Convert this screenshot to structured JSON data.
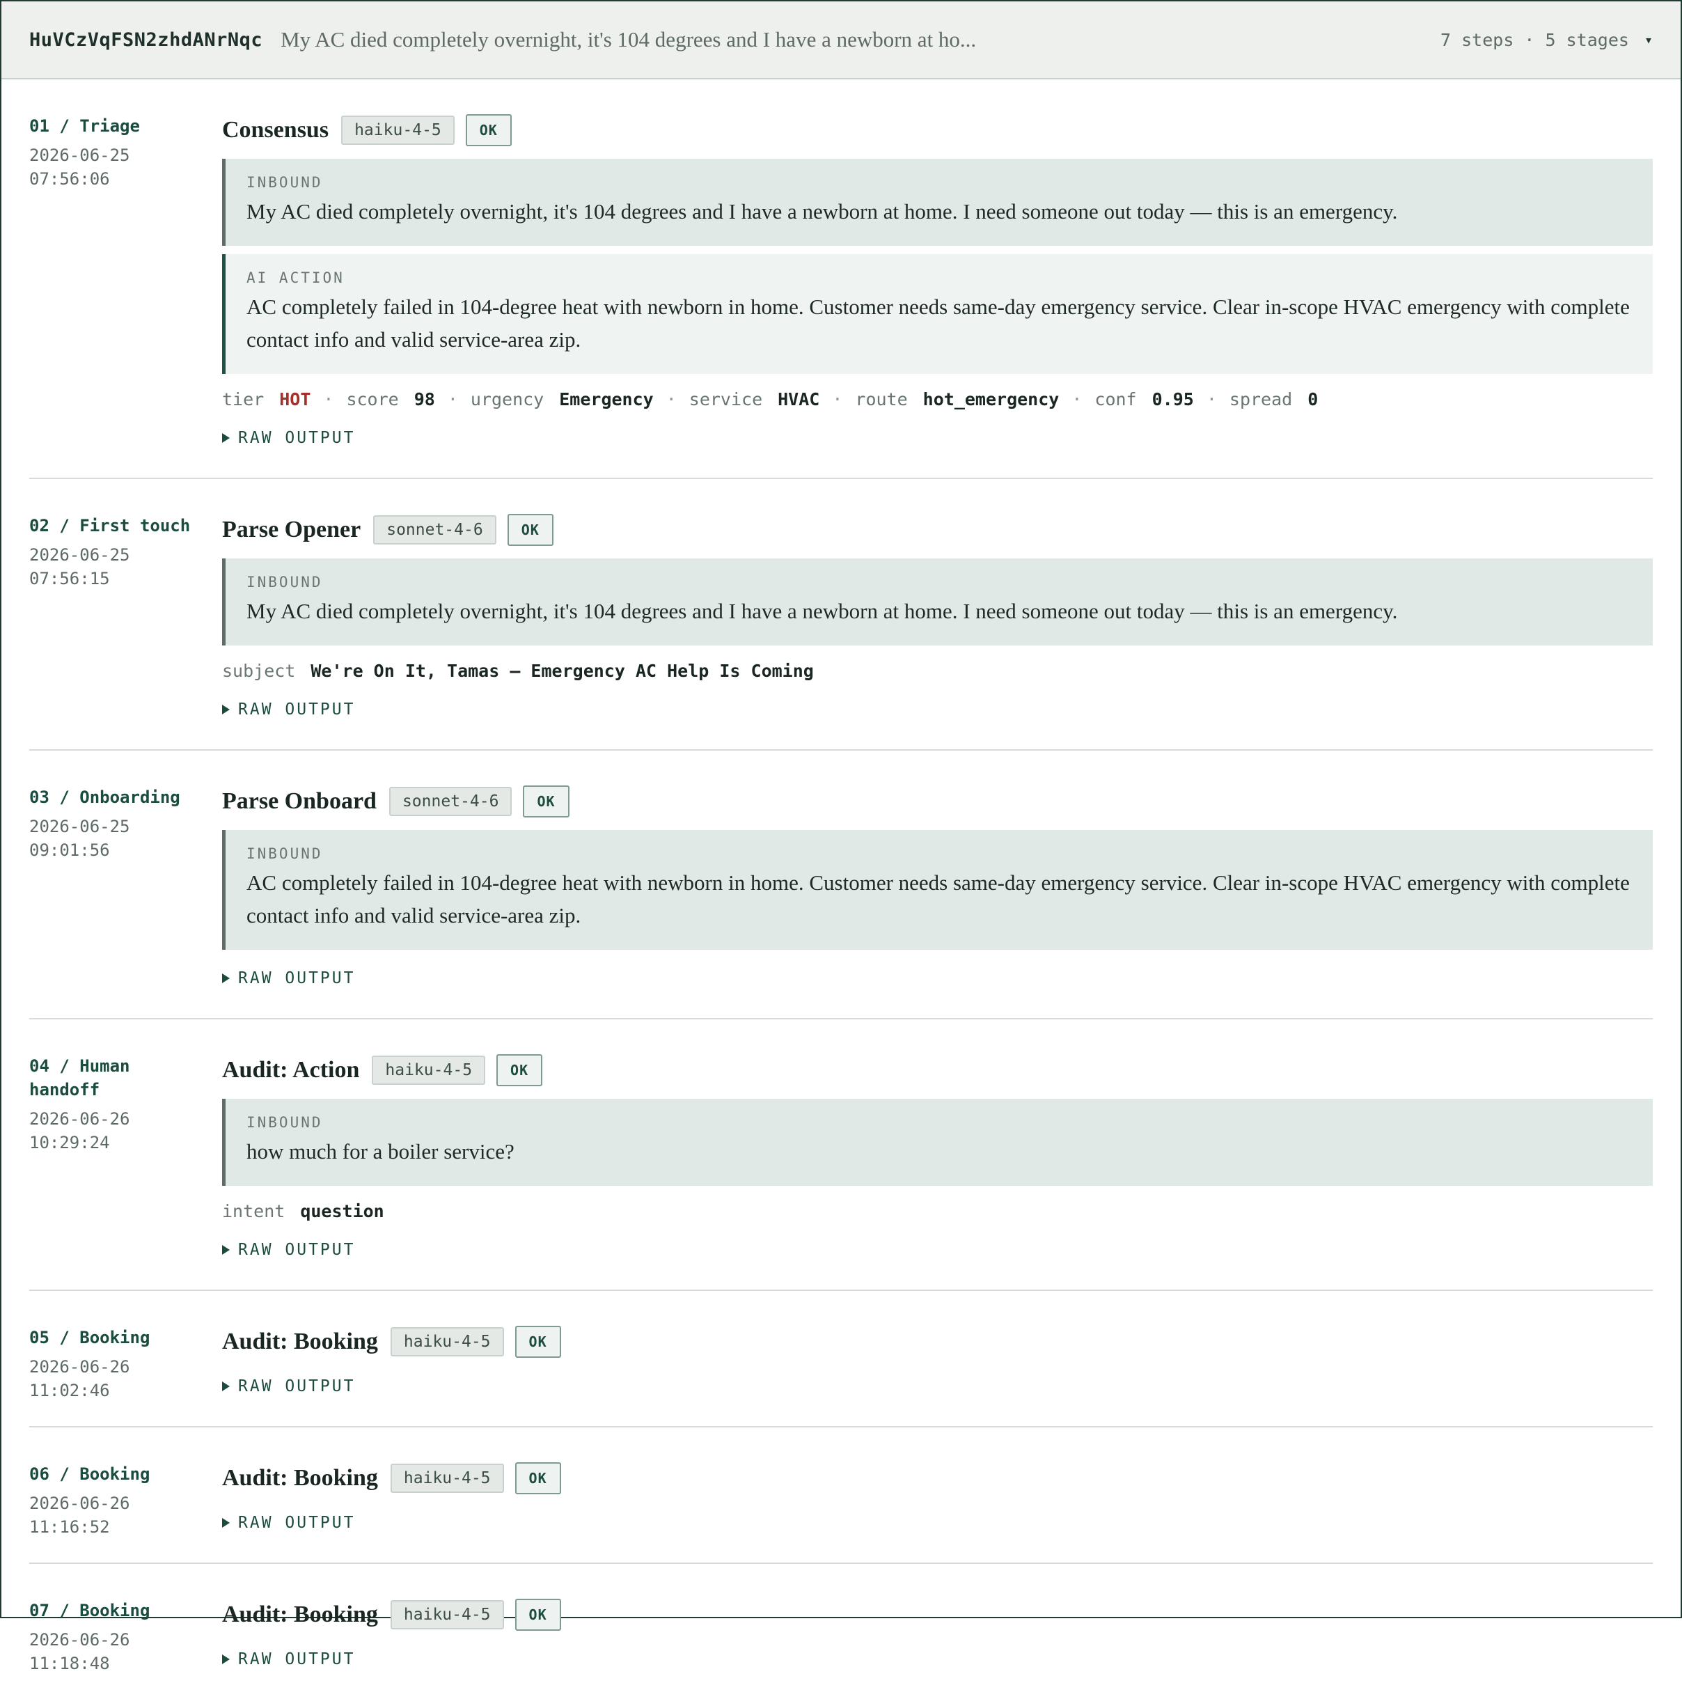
{
  "run": {
    "id": "HuVCzVqFSN2zhdANrNqc",
    "summary": "My AC died completely overnight, it's 104 degrees and I have a newborn at ho...",
    "meta": "7 steps · 5 stages",
    "chevron": "▾"
  },
  "labels": {
    "inbound": "INBOUND",
    "ai_action": "AI ACTION",
    "raw_output": "RAW OUTPUT",
    "ok": "OK"
  },
  "steps": [
    {
      "label": "01 / Triage",
      "date": "2026-06-25",
      "time": "07:56:06",
      "title": "Consensus",
      "model": "haiku-4-5",
      "status": "OK",
      "inbound": "My AC died completely overnight, it's 104 degrees and I have a newborn at home. I need someone out today — this is an emergency.",
      "ai_action": "AC completely failed in 104-degree heat with newborn in home. Customer needs same-day emergency service. Clear in-scope HVAC emergency with complete contact info and valid service-area zip.",
      "meta": [
        {
          "k": "tier",
          "v": "HOT"
        },
        {
          "k": "score",
          "v": "98"
        },
        {
          "k": "urgency",
          "v": "Emergency"
        },
        {
          "k": "service",
          "v": "HVAC"
        },
        {
          "k": "route",
          "v": "hot_emergency"
        },
        {
          "k": "conf",
          "v": "0.95"
        },
        {
          "k": "spread",
          "v": "0"
        }
      ]
    },
    {
      "label": "02 / First touch",
      "date": "2026-06-25",
      "time": "07:56:15",
      "title": "Parse Opener",
      "model": "sonnet-4-6",
      "status": "OK",
      "inbound": "My AC died completely overnight, it's 104 degrees and I have a newborn at home. I need someone out today — this is an emergency.",
      "meta": [
        {
          "k": "subject",
          "v": "We're On It, Tamas — Emergency AC Help Is Coming"
        }
      ]
    },
    {
      "label": "03 / Onboarding",
      "date": "2026-06-25",
      "time": "09:01:56",
      "title": "Parse Onboard",
      "model": "sonnet-4-6",
      "status": "OK",
      "inbound": "AC completely failed in 104-degree heat with newborn in home. Customer needs same-day emergency service. Clear in-scope HVAC emergency with complete contact info and valid service-area zip."
    },
    {
      "label_line1": "04 / Human",
      "label_line2": "handoff",
      "date": "2026-06-26",
      "time": "10:29:24",
      "title": "Audit: Action",
      "model": "haiku-4-5",
      "status": "OK",
      "inbound": "how much for a boiler service?",
      "meta": [
        {
          "k": "intent",
          "v": "question"
        }
      ]
    },
    {
      "label": "05 / Booking",
      "date": "2026-06-26",
      "time": "11:02:46",
      "title": "Audit: Booking",
      "model": "haiku-4-5",
      "status": "OK"
    },
    {
      "label": "06 / Booking",
      "date": "2026-06-26",
      "time": "11:16:52",
      "title": "Audit: Booking",
      "model": "haiku-4-5",
      "status": "OK"
    },
    {
      "label": "07 / Booking",
      "date": "2026-06-26",
      "time": "11:18:48",
      "title": "Audit: Booking",
      "model": "haiku-4-5",
      "status": "OK"
    }
  ]
}
